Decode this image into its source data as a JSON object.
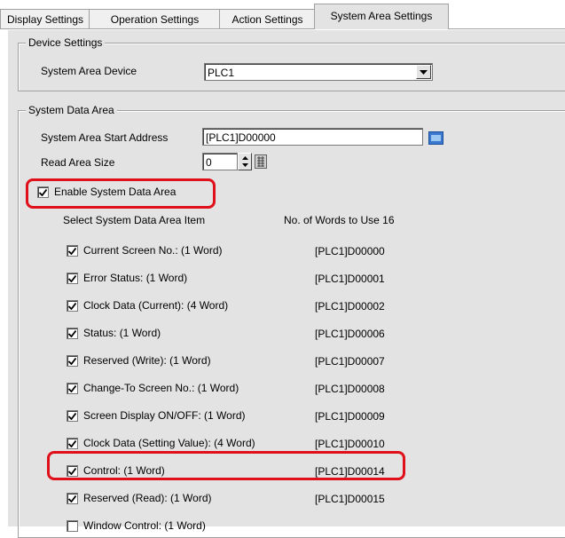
{
  "tabs": [
    "Display Settings",
    "Operation Settings",
    "Action Settings",
    "System Area Settings"
  ],
  "device_settings": {
    "legend": "Device Settings",
    "device_label": "System Area Device",
    "device_value": "PLC1"
  },
  "system_data_area": {
    "legend": "System Data Area",
    "start_address_label": "System Area Start Address",
    "start_address_value": "[PLC1]D00000",
    "read_size_label": "Read Area Size",
    "read_size_value": "0",
    "enable_label": "Enable System Data Area",
    "select_header": "Select System Data Area Item",
    "words_header": "No. of Words to Use 16",
    "items": [
      {
        "label": "Current Screen No.: (1 Word)",
        "address": "[PLC1]D00000",
        "checked": true
      },
      {
        "label": "Error Status: (1 Word)",
        "address": "[PLC1]D00001",
        "checked": true
      },
      {
        "label": "Clock Data (Current): (4 Word)",
        "address": "[PLC1]D00002",
        "checked": true
      },
      {
        "label": "Status: (1 Word)",
        "address": "[PLC1]D00006",
        "checked": true
      },
      {
        "label": "Reserved (Write): (1 Word)",
        "address": "[PLC1]D00007",
        "checked": true
      },
      {
        "label": "Change-To Screen No.: (1 Word)",
        "address": "[PLC1]D00008",
        "checked": true
      },
      {
        "label": "Screen Display ON/OFF: (1 Word)",
        "address": "[PLC1]D00009",
        "checked": true
      },
      {
        "label": "Clock Data (Setting Value): (4 Word)",
        "address": "[PLC1]D00010",
        "checked": true
      },
      {
        "label": "Control: (1 Word)",
        "address": "[PLC1]D00014",
        "checked": true
      },
      {
        "label": "Reserved (Read): (1 Word)",
        "address": "[PLC1]D00015",
        "checked": true
      },
      {
        "label": "Window Control: (1 Word)",
        "address": "",
        "checked": false
      }
    ]
  },
  "icons": {
    "dropdown": "chevron-down-icon",
    "address_picker": "keypad-icon",
    "spin": "spin-arrows-icon",
    "size_calc": "calculator-icon",
    "check": "checkmark-icon"
  },
  "colors": {
    "highlight": "#e0101b",
    "panel": "#e3e3e3",
    "picker_blue": "#3a78d0"
  }
}
